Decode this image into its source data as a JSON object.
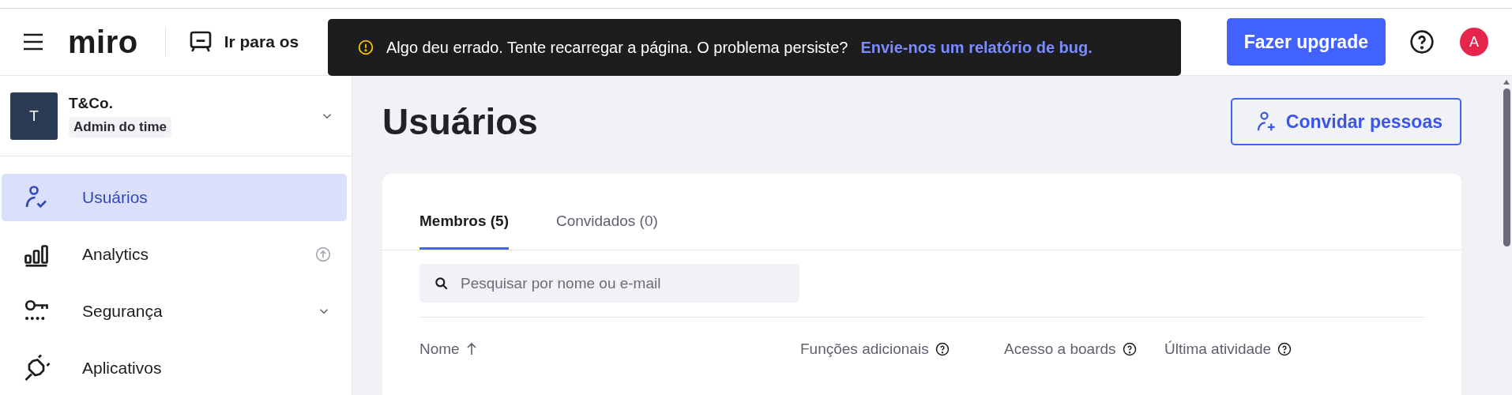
{
  "header": {
    "logo": "miro",
    "boards_link": "Ir para os",
    "upgrade_button": "Fazer upgrade",
    "avatar": "A"
  },
  "toast": {
    "message": "Algo deu errado. Tente recarregar a página. O problema persiste?",
    "link": "Envie-nos um relatório de bug."
  },
  "sidebar": {
    "team": {
      "initial": "T",
      "name": "T&Co.",
      "role": "Admin do time"
    },
    "items": [
      {
        "label": "Usuários",
        "kind": "users",
        "selected": true,
        "upgrade_badge": false,
        "expandable": false
      },
      {
        "label": "Analytics",
        "kind": "analytics",
        "selected": false,
        "upgrade_badge": true,
        "expandable": false
      },
      {
        "label": "Segurança",
        "kind": "security",
        "selected": false,
        "upgrade_badge": false,
        "expandable": true
      },
      {
        "label": "Aplicativos",
        "kind": "apps",
        "selected": false,
        "upgrade_badge": false,
        "expandable": false
      }
    ]
  },
  "main": {
    "title": "Usuários",
    "invite_button": "Convidar pessoas",
    "tabs": [
      {
        "label": "Membros (5)",
        "selected": true
      },
      {
        "label": "Convidados (0)",
        "selected": false
      }
    ],
    "search": {
      "placeholder": "Pesquisar por nome ou e-mail"
    },
    "columns": [
      {
        "label": "Nome",
        "sorted": true,
        "help": false
      },
      {
        "label": "Funções adicionais",
        "sorted": false,
        "help": true
      },
      {
        "label": "Acesso a boards",
        "sorted": false,
        "help": true
      },
      {
        "label": "Última atividade",
        "sorted": false,
        "help": true
      }
    ]
  }
}
